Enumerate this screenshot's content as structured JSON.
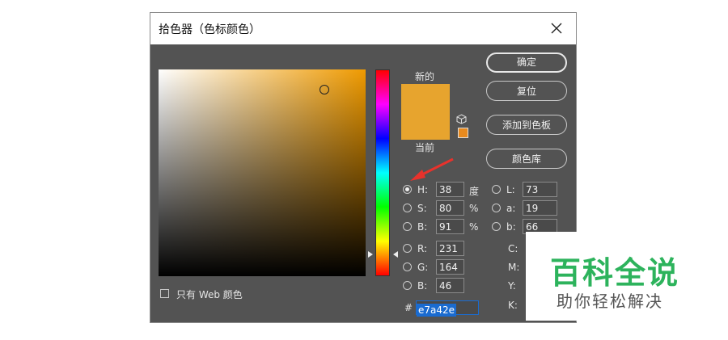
{
  "dialog": {
    "title": "拾色器（色标颜色）",
    "labels": {
      "new": "新的",
      "current": "当前"
    },
    "buttons": {
      "ok": "确定",
      "reset": "复位",
      "add_to_swatches": "添加到色板",
      "libraries": "颜色库"
    },
    "web_only": "只有 Web 颜色",
    "current_color": "#e7a42e",
    "hsb": [
      {
        "label": "H:",
        "value": "38",
        "unit": "度",
        "checked": true
      },
      {
        "label": "S:",
        "value": "80",
        "unit": "%"
      },
      {
        "label": "B:",
        "value": "91",
        "unit": "%"
      }
    ],
    "rgb": [
      {
        "label": "R:",
        "value": "231"
      },
      {
        "label": "G:",
        "value": "164"
      },
      {
        "label": "B:",
        "value": "46"
      }
    ],
    "lab": [
      {
        "label": "L:",
        "value": "73"
      },
      {
        "label": "a:",
        "value": "19"
      },
      {
        "label": "b:",
        "value": "66"
      }
    ],
    "cmyk_labels": [
      "C:",
      "M:",
      "Y:",
      "K:"
    ],
    "hex": {
      "label": "#",
      "value": "e7a42e"
    }
  },
  "watermark": {
    "title": "百科全说",
    "subtitle": "助你轻松解决"
  },
  "colors": {
    "accent_arrow": "#e8322c",
    "watermark_green": "#2db35c",
    "selection_blue": "#1a6bd0"
  }
}
